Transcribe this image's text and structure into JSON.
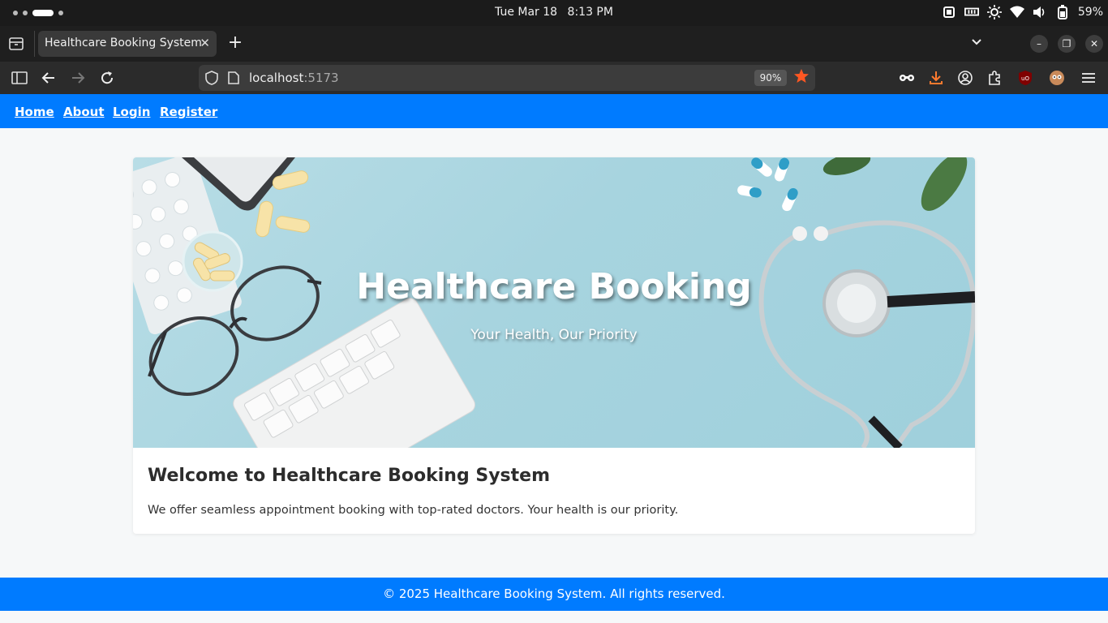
{
  "os": {
    "date": "Tue Mar 18",
    "time": "8:13 PM",
    "battery": "59%"
  },
  "browser": {
    "tab_title": "Healthcare Booking System",
    "url_host": "localhost",
    "url_port": ":5173",
    "zoom": "90%"
  },
  "site_nav": {
    "items": [
      {
        "label": "Home"
      },
      {
        "label": "About"
      },
      {
        "label": "Login"
      },
      {
        "label": "Register"
      }
    ]
  },
  "hero": {
    "title": "Healthcare Booking",
    "subtitle": "Your Health, Our Priority"
  },
  "main": {
    "heading": "Welcome to Healthcare Booking System",
    "description": "We offer seamless appointment booking with top-rated doctors. Your health is our priority."
  },
  "footer": {
    "text": "© 2025 Healthcare Booking System. All rights reserved."
  },
  "colors": {
    "brand": "#007bff",
    "star": "#ff5722"
  }
}
